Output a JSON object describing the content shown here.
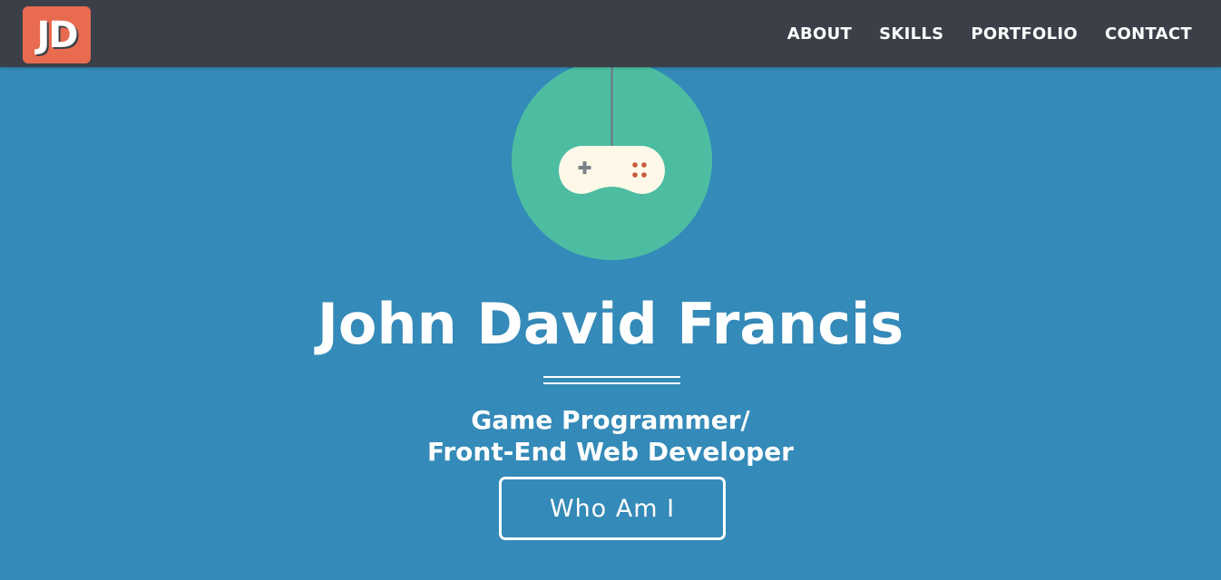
{
  "header": {
    "logo_text": "JD",
    "nav": [
      {
        "label": "ABOUT"
      },
      {
        "label": "SKILLS"
      },
      {
        "label": "PORTFOLIO"
      },
      {
        "label": "CONTACT"
      }
    ]
  },
  "hero": {
    "icon": "gamepad-icon",
    "name": "John David Francis",
    "subtitle_line1": "Game Programmer/",
    "subtitle_line2": "Front-End Web Developer",
    "button_label": "Who Am I"
  },
  "colors": {
    "background": "#348ab8",
    "navbar": "#3b3f48",
    "logo": "#e86b50",
    "circle": "#4dbda2",
    "controller": "#fdf8e7",
    "controller_buttons": "#c8583a",
    "dpad": "#7b7f88"
  }
}
